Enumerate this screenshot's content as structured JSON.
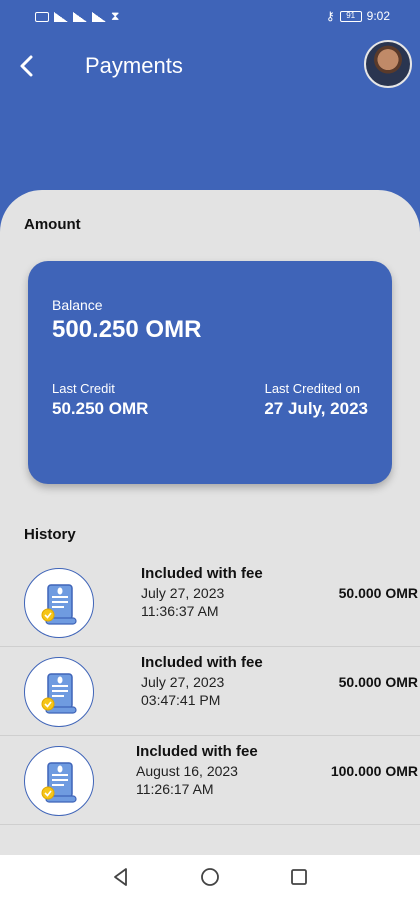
{
  "status_bar": {
    "left_icons": [
      "sim-icon",
      "signal-icon",
      "signal-icon",
      "wifi-icon",
      "hourglass-icon"
    ],
    "key_icon": "key-icon",
    "battery": "91",
    "time": "9:02"
  },
  "header": {
    "back_icon": "chevron-left-icon",
    "title": "Payments",
    "avatar": "profile-photo"
  },
  "amount": {
    "section_label": "Amount",
    "balance_label": "Balance",
    "balance_value": "500.250 OMR",
    "last_credit_label": "Last Credit",
    "last_credit_value": "50.250 OMR",
    "last_credited_on_label": "Last Credited on",
    "last_credited_on_value": "27 July, 2023"
  },
  "history": {
    "section_label": "History",
    "items": [
      {
        "title": "Included with fee",
        "date": "July 27, 2023",
        "time": "11:36:37 AM",
        "amount": "50.000 OMR",
        "icon": "receipt-scroll-icon"
      },
      {
        "title": "Included with fee",
        "date": "July 27, 2023",
        "time": "03:47:41 PM",
        "amount": "50.000 OMR",
        "icon": "receipt-scroll-icon"
      },
      {
        "title": "Included with fee",
        "date": "August 16, 2023",
        "time": "11:26:17 AM",
        "amount": "100.000 OMR",
        "icon": "receipt-scroll-icon"
      }
    ]
  },
  "nav_bar": {
    "back": "triangle-back-icon",
    "home": "circle-home-icon",
    "recent": "square-recents-icon"
  },
  "colors": {
    "primary": "#3f64b8",
    "sheet": "#e3e3e3",
    "accent_yellow": "#f5c518"
  }
}
